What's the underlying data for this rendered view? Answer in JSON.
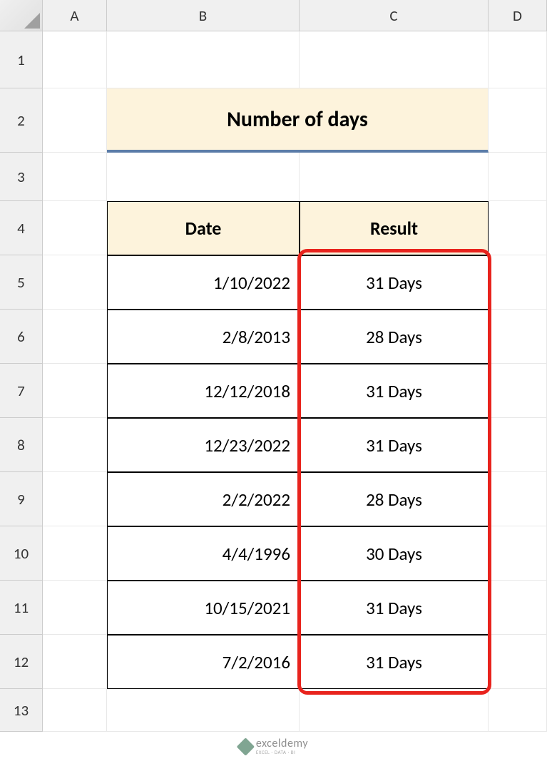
{
  "columns": [
    "A",
    "B",
    "C",
    "D"
  ],
  "rows": [
    "1",
    "2",
    "3",
    "4",
    "5",
    "6",
    "7",
    "8",
    "9",
    "10",
    "11",
    "12",
    "13"
  ],
  "title": "Number of days",
  "headers": {
    "date": "Date",
    "result": "Result"
  },
  "data": [
    {
      "date": "1/10/2022",
      "result": "31 Days"
    },
    {
      "date": "2/8/2013",
      "result": "28 Days"
    },
    {
      "date": "12/12/2018",
      "result": "31 Days"
    },
    {
      "date": "12/23/2022",
      "result": "31 Days"
    },
    {
      "date": "2/2/2022",
      "result": "28 Days"
    },
    {
      "date": "4/4/1996",
      "result": "30 Days"
    },
    {
      "date": "10/15/2021",
      "result": "31 Days"
    },
    {
      "date": "7/2/2016",
      "result": "31 Days"
    }
  ],
  "watermark": {
    "main": "exceldemy",
    "sub": "EXCEL · DATA · BI"
  }
}
